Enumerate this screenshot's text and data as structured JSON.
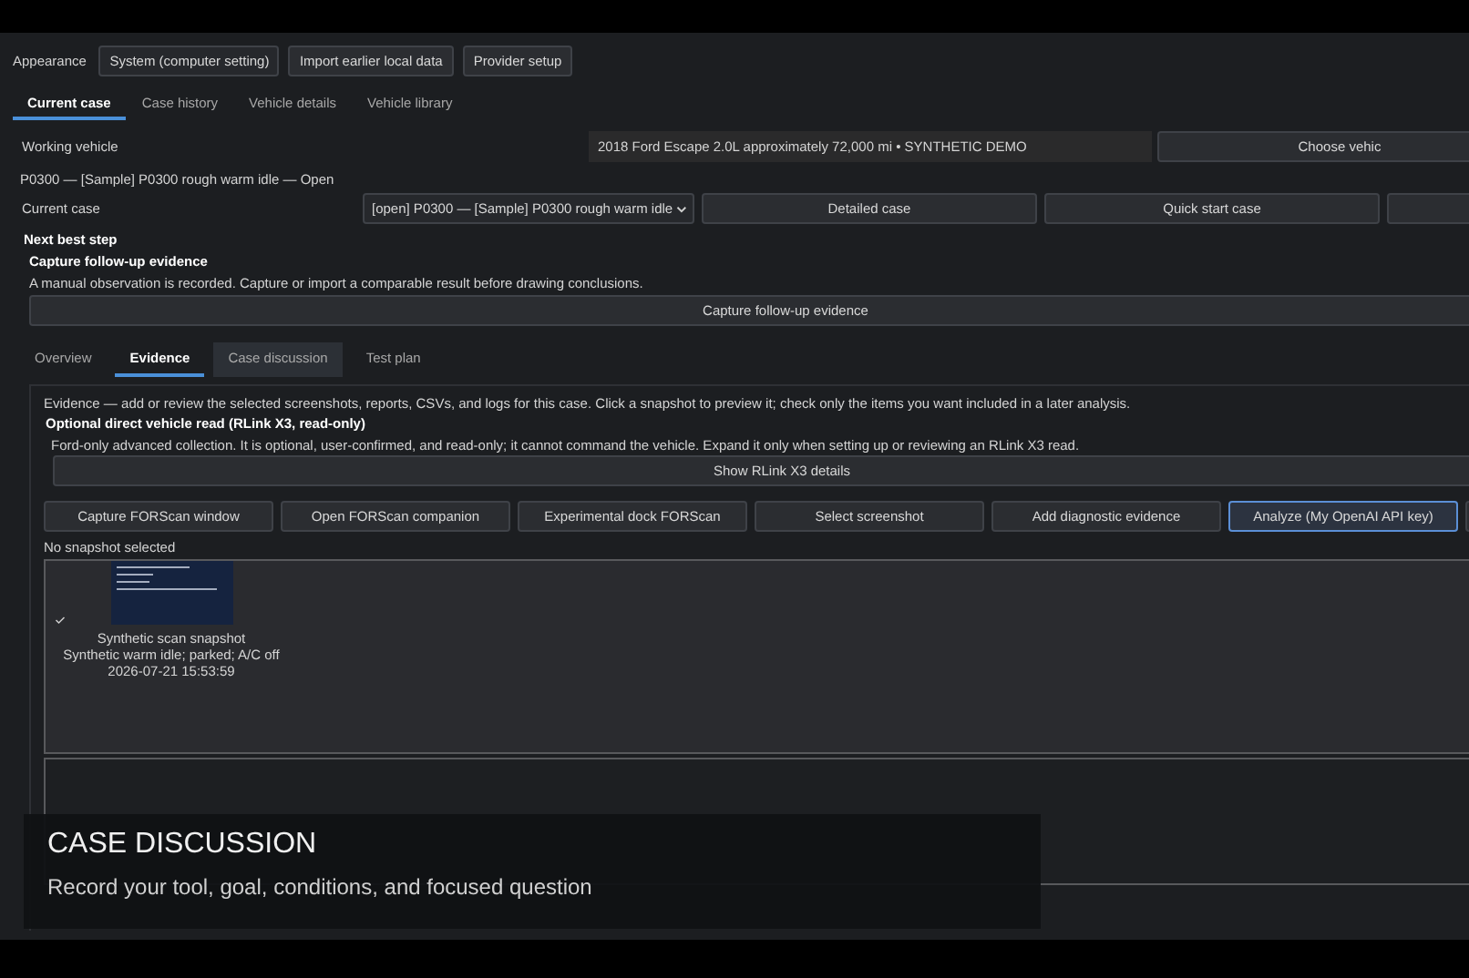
{
  "toolbar": {
    "appearance_label": "Appearance",
    "appearance_value": "System (computer setting)",
    "buttons": [
      "Import earlier local data",
      "Provider setup"
    ]
  },
  "main_tabs": [
    {
      "label": "Current case",
      "selected": true
    },
    {
      "label": "Case history",
      "selected": false
    },
    {
      "label": "Vehicle details",
      "selected": false
    },
    {
      "label": "Vehicle library",
      "selected": false
    }
  ],
  "working_vehicle": {
    "label": "Working vehicle",
    "value": "2018 Ford Escape 2.0L approximately 72,000 mi  • SYNTHETIC DEMO",
    "button": "Choose vehic"
  },
  "case_title": "P0300 — [Sample] P0300 rough warm idle — Open",
  "current_case": {
    "label": "Current case",
    "value": "[open] P0300 — [Sample] P0300 rough warm idle",
    "buttons": [
      "Detailed case",
      "Quick start case"
    ]
  },
  "next_step": {
    "heading": "Next best step",
    "title": "Capture follow-up evidence",
    "description": "A manual observation is recorded. Capture or import a comparable result before drawing conclusions.",
    "button": "Capture follow-up evidence"
  },
  "sub_tabs": [
    {
      "label": "Overview",
      "selected": false,
      "hovered": false
    },
    {
      "label": "Evidence",
      "selected": true,
      "hovered": false
    },
    {
      "label": "Case discussion",
      "selected": false,
      "hovered": true
    },
    {
      "label": "Test plan",
      "selected": false,
      "hovered": false
    }
  ],
  "evidence": {
    "intro": "Evidence — add or review the selected screenshots, reports, CSVs, and logs for this case. Click a snapshot to preview it; check only the items you want included in a later analysis.",
    "direct_read": {
      "title": "Optional direct vehicle read (RLink X3, read-only)",
      "description": "Ford-only advanced collection. It is optional, user-confirmed, and read-only; it cannot command the vehicle. Expand it only when setting up or reviewing an RLink X3 read.",
      "button": "Show RLink X3 details"
    },
    "actions": [
      {
        "label": "Capture FORScan window",
        "focused": false
      },
      {
        "label": "Open FORScan companion",
        "focused": false
      },
      {
        "label": "Experimental dock FORScan",
        "focused": false
      },
      {
        "label": "Select screenshot",
        "focused": false
      },
      {
        "label": "Add diagnostic evidence",
        "focused": false
      },
      {
        "label": "Analyze (My OpenAI API key)",
        "focused": true
      }
    ],
    "selection_status": "No snapshot selected",
    "snapshots": [
      {
        "title": "Synthetic scan snapshot",
        "conditions": "Synthetic warm idle; parked; A/C off",
        "timestamp": "2026-07-21 15:53:59",
        "checked": true
      }
    ]
  },
  "caption": {
    "title": "CASE DISCUSSION",
    "subtitle": "Record your tool, goal, conditions, and focused question"
  }
}
